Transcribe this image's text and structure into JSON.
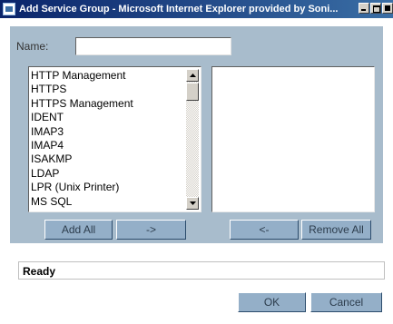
{
  "window": {
    "title": "Add Service Group - Microsoft Internet Explorer provided by Soni..."
  },
  "form": {
    "name_label": "Name:",
    "name_value": ""
  },
  "available_services": {
    "items": [
      "HTTP Management",
      "HTTPS",
      "HTTPS Management",
      "IDENT",
      "IMAP3",
      "IMAP4",
      "ISAKMP",
      "LDAP",
      "LPR (Unix Printer)",
      "MS SQL"
    ]
  },
  "selected_services": {
    "items": []
  },
  "buttons": {
    "add_all": "Add All",
    "add": "->",
    "remove": "<-",
    "remove_all": "Remove All",
    "ok": "OK",
    "cancel": "Cancel"
  },
  "status": {
    "text": "Ready"
  },
  "colors": {
    "panel": "#a8bccc",
    "button": "#94afc8",
    "titlebar": "#0a246a"
  }
}
